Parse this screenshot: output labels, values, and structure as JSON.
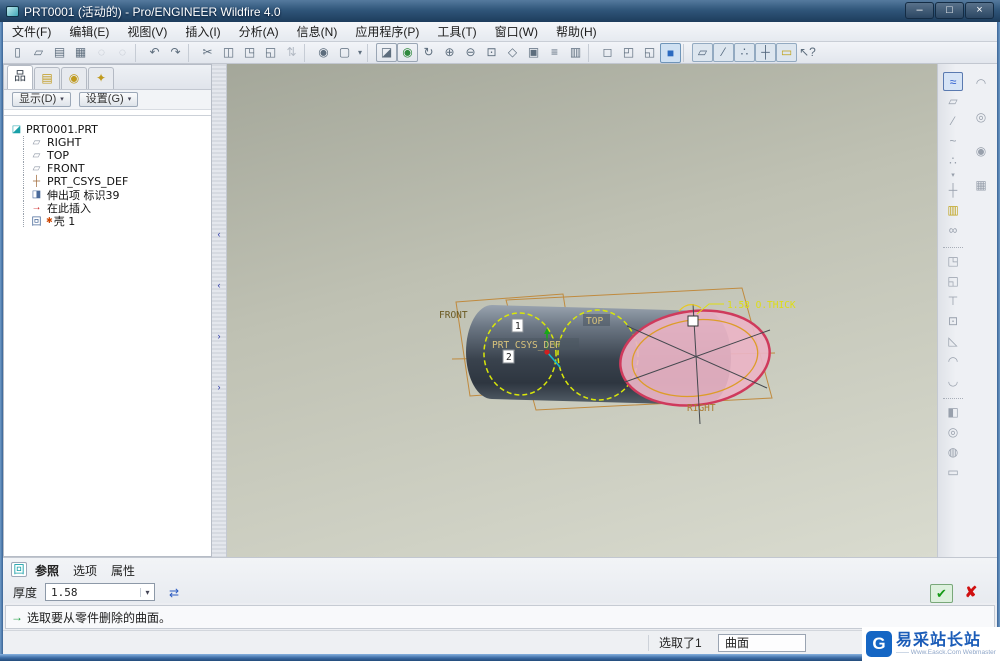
{
  "window": {
    "title": "PRT0001 (活动的) - Pro/ENGINEER Wildfire 4.0",
    "controls": [
      {
        "glyph": "–",
        "name": "minimize-button"
      },
      {
        "glyph": "□",
        "name": "maximize-button"
      },
      {
        "glyph": "×",
        "name": "close-button"
      }
    ]
  },
  "menu": {
    "items": [
      "文件(F)",
      "编辑(E)",
      "视图(V)",
      "插入(I)",
      "分析(A)",
      "信息(N)",
      "应用程序(P)",
      "工具(T)",
      "窗口(W)",
      "帮助(H)"
    ]
  },
  "toolbar": {
    "items": [
      {
        "glyph": "▯",
        "name": "new-button",
        "cls": "ti",
        "inter": "true"
      },
      {
        "glyph": "▱",
        "name": "open-button",
        "cls": "ti",
        "inter": "true"
      },
      {
        "glyph": "▤",
        "name": "save-button",
        "cls": "ti",
        "inter": "true"
      },
      {
        "glyph": "▦",
        "name": "print-button",
        "cls": "ti",
        "inter": "true"
      },
      {
        "glyph": "◌",
        "name": "email-button",
        "cls": "ti dis",
        "inter": "true"
      },
      {
        "glyph": "◌",
        "name": "model-info-button",
        "cls": "ti dis",
        "inter": "true"
      },
      {
        "glyph": "",
        "name": "toolbar-separator",
        "cls": "tsep",
        "inter": "false"
      },
      {
        "glyph": "↶",
        "name": "undo-button",
        "cls": "ti",
        "inter": "true"
      },
      {
        "glyph": "↷",
        "name": "redo-button",
        "cls": "ti",
        "inter": "true"
      },
      {
        "glyph": "",
        "name": "toolbar-separator",
        "cls": "tsep",
        "inter": "false"
      },
      {
        "glyph": "✂",
        "name": "cut-button",
        "cls": "ti",
        "inter": "true"
      },
      {
        "glyph": "◫",
        "name": "copy-button",
        "cls": "ti",
        "inter": "true"
      },
      {
        "glyph": "◳",
        "name": "paste-button",
        "cls": "ti",
        "inter": "true"
      },
      {
        "glyph": "◱",
        "name": "paste-special-button",
        "cls": "ti",
        "inter": "true"
      },
      {
        "glyph": "⇅",
        "name": "regenerate-button",
        "cls": "ti dis",
        "inter": "true"
      },
      {
        "glyph": "",
        "name": "toolbar-separator",
        "cls": "tsep",
        "inter": "false"
      },
      {
        "glyph": "◉",
        "name": "find-button",
        "cls": "ti",
        "inter": "true"
      },
      {
        "glyph": "▢",
        "name": "select-box-button",
        "cls": "ti",
        "inter": "true"
      },
      {
        "glyph": "▾",
        "name": "select-box-caret",
        "cls": "ti caret",
        "inter": "true"
      },
      {
        "glyph": "",
        "name": "toolbar-separator",
        "cls": "tsep",
        "inter": "false"
      },
      {
        "glyph": "◪",
        "name": "datum-filter-toggle",
        "cls": "ti framed",
        "inter": "true"
      },
      {
        "glyph": "◉",
        "name": "spin-center-toggle",
        "cls": "ti framed spin",
        "inter": "true"
      },
      {
        "glyph": "↻",
        "name": "orient-mode-toggle",
        "cls": "ti",
        "inter": "true"
      },
      {
        "glyph": "⊕",
        "name": "zoom-in-button",
        "cls": "ti",
        "inter": "true"
      },
      {
        "glyph": "⊖",
        "name": "zoom-out-button",
        "cls": "ti",
        "inter": "true"
      },
      {
        "glyph": "⊡",
        "name": "refit-button",
        "cls": "ti",
        "inter": "true"
      },
      {
        "glyph": "◇",
        "name": "reorient-button",
        "cls": "ti",
        "inter": "true"
      },
      {
        "glyph": "▣",
        "name": "saved-views-button",
        "cls": "ti",
        "inter": "true"
      },
      {
        "glyph": "≡",
        "name": "layers-button",
        "cls": "ti",
        "inter": "true"
      },
      {
        "glyph": "▥",
        "name": "view-manager-button",
        "cls": "ti",
        "inter": "true"
      },
      {
        "glyph": "",
        "name": "toolbar-separator",
        "cls": "tsep",
        "inter": "false"
      },
      {
        "glyph": "◻",
        "name": "wireframe-button",
        "cls": "ti",
        "inter": "true"
      },
      {
        "glyph": "◰",
        "name": "hidden-line-button",
        "cls": "ti",
        "inter": "true"
      },
      {
        "glyph": "◱",
        "name": "no-hidden-button",
        "cls": "ti",
        "inter": "true"
      },
      {
        "glyph": "■",
        "name": "shaded-button",
        "cls": "ti on",
        "inter": "true"
      },
      {
        "glyph": "",
        "name": "toolbar-separator",
        "cls": "tsep",
        "inter": "false"
      },
      {
        "glyph": "▱",
        "name": "datum-planes-toggle",
        "cls": "ti framed on2",
        "inter": "true"
      },
      {
        "glyph": "⁄",
        "name": "datum-axes-toggle",
        "cls": "ti framed on2",
        "inter": "true"
      },
      {
        "glyph": "∴",
        "name": "datum-points-toggle",
        "cls": "ti framed on2",
        "inter": "true"
      },
      {
        "glyph": "┼",
        "name": "csys-toggle",
        "cls": "ti framed on2",
        "inter": "true"
      },
      {
        "glyph": "▭",
        "name": "annotations-toggle",
        "cls": "ti framed on2 note",
        "inter": "true"
      },
      {
        "glyph": "↖?",
        "name": "context-help-button",
        "cls": "ti",
        "inter": "true"
      }
    ]
  },
  "navigator": {
    "tabs": [
      {
        "glyph": "品",
        "name": "tab-model-tree",
        "cls": "ntab active",
        "inter": "true"
      },
      {
        "glyph": "▤",
        "name": "tab-folder-browser",
        "cls": "ntab yellow",
        "inter": "true"
      },
      {
        "glyph": "◉",
        "name": "tab-favorites",
        "cls": "ntab yellow",
        "inter": "true"
      },
      {
        "glyph": "✦",
        "name": "tab-connections",
        "cls": "ntab yellow",
        "inter": "true"
      }
    ],
    "show_button": "显示(D)",
    "settings_button": "设置(G)",
    "caret": "▾"
  },
  "model_tree": {
    "root_icon": "◪",
    "root": "PRT0001.PRT",
    "items": [
      {
        "glyph": "▱",
        "icon": "datum-plane-icon",
        "cls": "tglyph plane",
        "marker": "",
        "label": "RIGHT"
      },
      {
        "glyph": "▱",
        "icon": "datum-plane-icon",
        "cls": "tglyph plane",
        "marker": "",
        "label": "TOP"
      },
      {
        "glyph": "▱",
        "icon": "datum-plane-icon",
        "cls": "tglyph plane",
        "marker": "",
        "label": "FRONT"
      },
      {
        "glyph": "┼",
        "icon": "csys-icon",
        "cls": "tglyph csys",
        "marker": "",
        "label": "PRT_CSYS_DEF"
      },
      {
        "glyph": "◨",
        "icon": "extrude-icon",
        "cls": "tglyph feat",
        "marker": "",
        "label": "伸出项 标识39"
      },
      {
        "glyph": "→",
        "icon": "insert-here-icon",
        "cls": "tglyph insert",
        "marker": "",
        "label": "在此插入"
      },
      {
        "glyph": "回",
        "icon": "shell-icon",
        "cls": "tglyph feat",
        "marker": "✱",
        "label": "壳 1"
      }
    ]
  },
  "splitter": {
    "arrows": [
      "‹",
      "‹",
      "›",
      "›"
    ]
  },
  "viewport": {
    "labels": {
      "front": "FRONT",
      "top": "TOP",
      "right": "RIGHT",
      "csys": "PRT_CSYS_DEF"
    },
    "annotation": "1.58 O.THICK",
    "tags": [
      "1",
      "2"
    ],
    "colors": {
      "selected_face": "#eab4c6",
      "selected_edge": "#cf3a5c",
      "preview_dash": "#d8e60a",
      "datum_wire": "#c08a3e",
      "annotation_text": "#dede12"
    }
  },
  "rail": {
    "col1": [
      {
        "glyph": "≈",
        "name": "style-tool-button",
        "cls": "ri on",
        "inter": "true"
      },
      {
        "glyph": "▱",
        "name": "datum-plane-tool",
        "cls": "ri",
        "inter": "true"
      },
      {
        "glyph": "⁄",
        "name": "datum-axis-tool",
        "cls": "ri",
        "inter": "true"
      },
      {
        "glyph": "~",
        "name": "curve-tool",
        "cls": "ri",
        "inter": "true"
      },
      {
        "glyph": "∴",
        "name": "datum-point-tool",
        "cls": "ri",
        "inter": "true"
      },
      {
        "glyph": "▾",
        "name": "datum-point-caret",
        "cls": "ri caret",
        "inter": "true"
      },
      {
        "glyph": "┼",
        "name": "csys-tool",
        "cls": "ri",
        "inter": "true"
      },
      {
        "glyph": "▥",
        "name": "analysis-tool",
        "cls": "ri yellow",
        "inter": "true"
      },
      {
        "glyph": "∞",
        "name": "link-tool",
        "cls": "ri",
        "inter": "true"
      },
      {
        "glyph": "",
        "name": "rail-separator",
        "cls": "rsep",
        "inter": "false"
      },
      {
        "glyph": "◳",
        "name": "copy-geom-tool",
        "cls": "ri",
        "inter": "true"
      },
      {
        "glyph": "◱",
        "name": "publish-geom-tool",
        "cls": "ri",
        "inter": "true"
      },
      {
        "glyph": "⊤",
        "name": "trim-tool",
        "cls": "ri",
        "inter": "true"
      },
      {
        "glyph": "⊡",
        "name": "merge-tool",
        "cls": "ri",
        "inter": "true"
      },
      {
        "glyph": "◺",
        "name": "draft-tool",
        "cls": "ri",
        "inter": "true"
      },
      {
        "glyph": "◠",
        "name": "round-tool",
        "cls": "ri",
        "inter": "true"
      },
      {
        "glyph": "◡",
        "name": "chamfer-tool",
        "cls": "ri",
        "inter": "true"
      },
      {
        "glyph": "",
        "name": "rail-separator",
        "cls": "rsep",
        "inter": "false"
      },
      {
        "glyph": "◧",
        "name": "thicken-tool",
        "cls": "ri",
        "inter": "true"
      },
      {
        "glyph": "◎",
        "name": "solidify-tool",
        "cls": "ri",
        "inter": "true"
      },
      {
        "glyph": "◍",
        "name": "intersect-tool",
        "cls": "ri",
        "inter": "true"
      },
      {
        "glyph": "▭",
        "name": "flatten-tool",
        "cls": "ri",
        "inter": "true"
      }
    ],
    "col2": [
      {
        "glyph": "◠",
        "name": "round-edge-tool",
        "cls": "ri",
        "inter": "true"
      },
      {
        "glyph": "◎",
        "name": "chamfer-edge-tool",
        "cls": "ri",
        "inter": "true"
      },
      {
        "glyph": "◉",
        "name": "hole-tool",
        "cls": "ri",
        "inter": "true"
      },
      {
        "glyph": "▦",
        "name": "pattern-tool",
        "cls": "ri",
        "inter": "true"
      }
    ]
  },
  "dashboard": {
    "feature_icon": "回",
    "tabs": [
      {
        "label": "参照",
        "name": "dashboard-tab-references",
        "cls": "dtab active",
        "inter": "true"
      },
      {
        "label": "选项",
        "name": "dashboard-tab-options",
        "cls": "dtab",
        "inter": "true"
      },
      {
        "label": "属性",
        "name": "dashboard-tab-properties",
        "cls": "dtab",
        "inter": "true"
      }
    ],
    "thickness_label": "厚度",
    "thickness_value": "1.58",
    "flip_icon": "⇄",
    "ok_icon": "✔",
    "cancel_icon": "✘"
  },
  "status": {
    "message": "选取要从零件删除的曲面。",
    "selected_count": "选取了1",
    "filter_value": "曲面"
  },
  "watermark": {
    "logo": "G",
    "title": "易采站长站",
    "subtitle": "—— Www.Easck.Com Webmaster"
  }
}
